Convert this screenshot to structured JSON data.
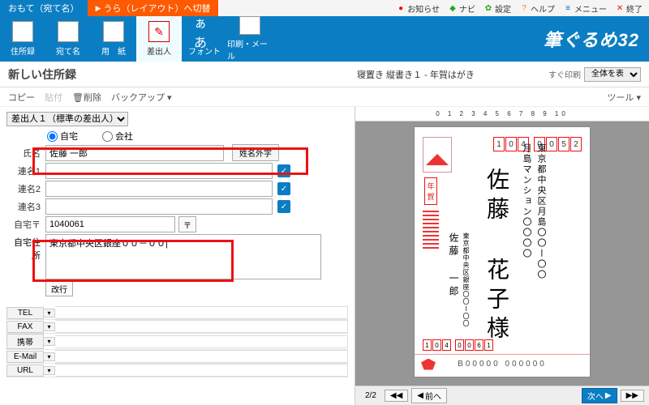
{
  "tabs": {
    "front": "おもて（宛て名）",
    "back": "うら（レイアウト）へ切替"
  },
  "sysmenu": {
    "news": "お知らせ",
    "navi": "ナビ",
    "settings": "設定",
    "help": "ヘルプ",
    "menu": "メニュー",
    "exit": "終了"
  },
  "ribbon": {
    "addressbook": "住所録",
    "atena": "宛て名",
    "paper": "用　紙",
    "sender": "差出人",
    "font": "フォント",
    "print": "印刷・メール",
    "fonticon": "ぁあ"
  },
  "brand": "筆ぐるめ32",
  "subheader": {
    "title": "新しい住所録",
    "preview": "寝置き 縦書き１ - 年賀はがき",
    "printnow": "すぐ印刷",
    "viewsel": "全体を表示"
  },
  "toolbar": {
    "copy": "コピー",
    "paste": "貼付",
    "delete": "削除",
    "backup": "バックアップ ▾",
    "tool": "ツール ▾"
  },
  "form": {
    "sender_select": "差出人１（標準の差出人）",
    "radio_home": "自宅",
    "radio_company": "会社",
    "lbl_name": "氏名",
    "name_value": "佐藤 一郎",
    "gaiji": "姓名外字",
    "lbl_ren1": "連名1",
    "lbl_ren2": "連名2",
    "lbl_ren3": "連名3",
    "lbl_zip": "自宅〒",
    "zip_value": "1040061",
    "zip_btn": "〒",
    "lbl_addr": "自宅住所",
    "addr_value": "東京都中央区銀座００－００|",
    "kaigyo": "改行",
    "contacts": {
      "tel": "TEL",
      "fax": "FAX",
      "mobile": "携帯",
      "email": "E-Mail",
      "url": "URL"
    }
  },
  "postcard": {
    "zip": [
      "1",
      "0",
      "4",
      "0",
      "0",
      "5",
      "2"
    ],
    "nenga1": "年",
    "nenga2": "賀",
    "recip_addr1": "東京都中央区月島〇〇ー〇〇",
    "recip_addr2": "月島マンション〇〇〇〇",
    "recip_name": "佐藤 花子様",
    "sender_addr": "東京都中央区銀座〇〇ー〇〇",
    "sender_name": "佐藤 一郎",
    "sender_zip": [
      "1",
      "0",
      "4",
      "0",
      "0",
      "6",
      "1"
    ],
    "lottery": "B00000  000000"
  },
  "ruler": "0 1 2 3 4 5 6 7 8 9 10",
  "nav": {
    "page": "2/2",
    "prev": "前へ",
    "next": "次へ"
  }
}
